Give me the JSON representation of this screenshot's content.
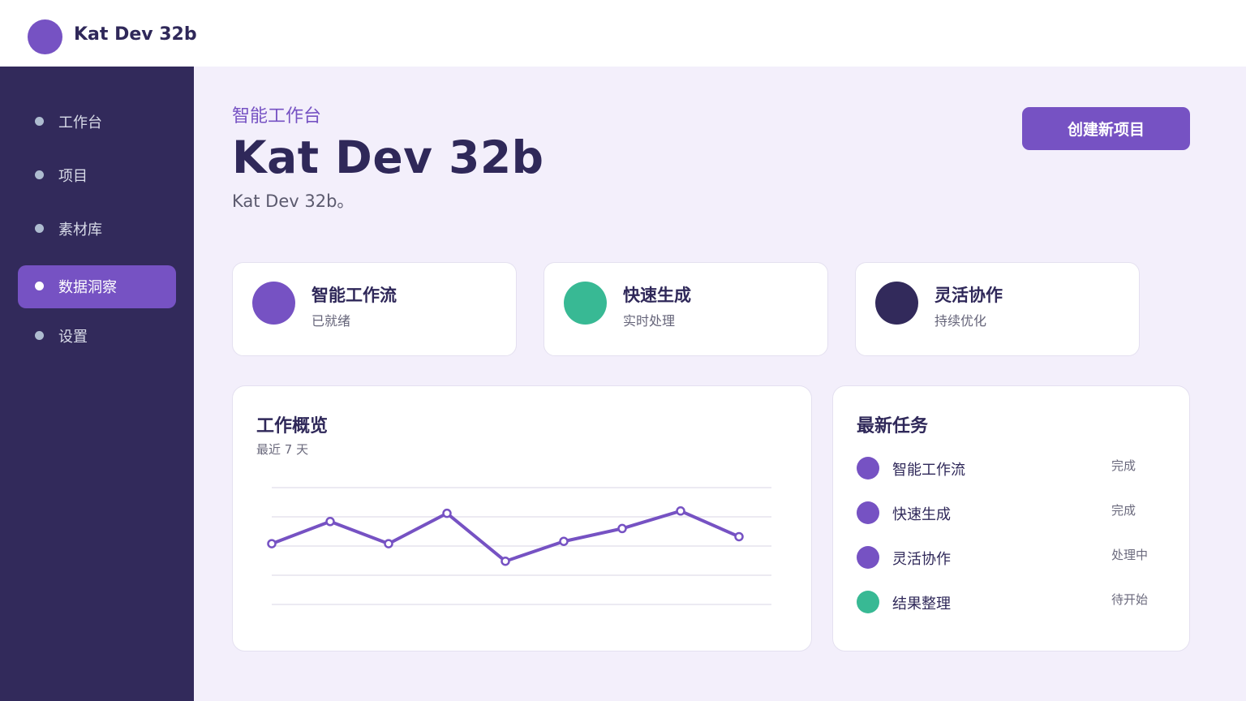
{
  "app": {
    "title": "Kat Dev 32b"
  },
  "sidebar": {
    "items": [
      {
        "label": "工作台",
        "active": false
      },
      {
        "label": "项目",
        "active": false
      },
      {
        "label": "素材库",
        "active": false
      },
      {
        "label": "数据洞察",
        "active": true
      },
      {
        "label": "设置",
        "active": false
      }
    ]
  },
  "header": {
    "eyebrow": "智能工作台",
    "title": "Kat Dev 32b",
    "subtitle": "Kat Dev 32b。",
    "create_button": "创建新项目"
  },
  "stats": [
    {
      "title": "智能工作流",
      "subtitle": "已就绪",
      "color": "#7652c3"
    },
    {
      "title": "快速生成",
      "subtitle": "实时处理",
      "color": "#38b994"
    },
    {
      "title": "灵活协作",
      "subtitle": "持续优化",
      "color": "#322a5b"
    }
  ],
  "overview": {
    "title": "工作概览",
    "subtitle": "最近 7 天"
  },
  "chart_data": {
    "type": "line",
    "values": [
      52,
      71,
      52,
      78,
      37,
      54,
      65,
      80,
      58
    ],
    "ylim": [
      0,
      100
    ],
    "grid": true,
    "color": "#7652c3"
  },
  "tasks": {
    "title": "最新任务",
    "items": [
      {
        "name": "智能工作流",
        "status": "完成",
        "color": "#7652c3"
      },
      {
        "name": "快速生成",
        "status": "完成",
        "color": "#7652c3"
      },
      {
        "name": "灵活协作",
        "status": "处理中",
        "color": "#7652c3"
      },
      {
        "name": "结果整理",
        "status": "待开始",
        "color": "#38b994"
      }
    ]
  }
}
